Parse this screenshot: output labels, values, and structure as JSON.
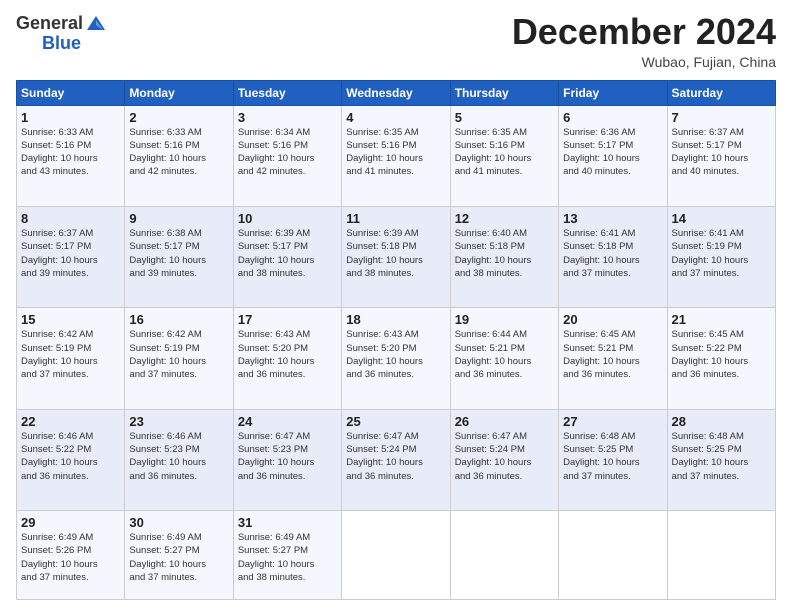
{
  "header": {
    "logo_general": "General",
    "logo_blue": "Blue",
    "month_title": "December 2024",
    "location": "Wubao, Fujian, China"
  },
  "days_of_week": [
    "Sunday",
    "Monday",
    "Tuesday",
    "Wednesday",
    "Thursday",
    "Friday",
    "Saturday"
  ],
  "weeks": [
    [
      {
        "day": "1",
        "info": "Sunrise: 6:33 AM\nSunset: 5:16 PM\nDaylight: 10 hours\nand 43 minutes."
      },
      {
        "day": "2",
        "info": "Sunrise: 6:33 AM\nSunset: 5:16 PM\nDaylight: 10 hours\nand 42 minutes."
      },
      {
        "day": "3",
        "info": "Sunrise: 6:34 AM\nSunset: 5:16 PM\nDaylight: 10 hours\nand 42 minutes."
      },
      {
        "day": "4",
        "info": "Sunrise: 6:35 AM\nSunset: 5:16 PM\nDaylight: 10 hours\nand 41 minutes."
      },
      {
        "day": "5",
        "info": "Sunrise: 6:35 AM\nSunset: 5:16 PM\nDaylight: 10 hours\nand 41 minutes."
      },
      {
        "day": "6",
        "info": "Sunrise: 6:36 AM\nSunset: 5:17 PM\nDaylight: 10 hours\nand 40 minutes."
      },
      {
        "day": "7",
        "info": "Sunrise: 6:37 AM\nSunset: 5:17 PM\nDaylight: 10 hours\nand 40 minutes."
      }
    ],
    [
      {
        "day": "8",
        "info": "Sunrise: 6:37 AM\nSunset: 5:17 PM\nDaylight: 10 hours\nand 39 minutes."
      },
      {
        "day": "9",
        "info": "Sunrise: 6:38 AM\nSunset: 5:17 PM\nDaylight: 10 hours\nand 39 minutes."
      },
      {
        "day": "10",
        "info": "Sunrise: 6:39 AM\nSunset: 5:17 PM\nDaylight: 10 hours\nand 38 minutes."
      },
      {
        "day": "11",
        "info": "Sunrise: 6:39 AM\nSunset: 5:18 PM\nDaylight: 10 hours\nand 38 minutes."
      },
      {
        "day": "12",
        "info": "Sunrise: 6:40 AM\nSunset: 5:18 PM\nDaylight: 10 hours\nand 38 minutes."
      },
      {
        "day": "13",
        "info": "Sunrise: 6:41 AM\nSunset: 5:18 PM\nDaylight: 10 hours\nand 37 minutes."
      },
      {
        "day": "14",
        "info": "Sunrise: 6:41 AM\nSunset: 5:19 PM\nDaylight: 10 hours\nand 37 minutes."
      }
    ],
    [
      {
        "day": "15",
        "info": "Sunrise: 6:42 AM\nSunset: 5:19 PM\nDaylight: 10 hours\nand 37 minutes."
      },
      {
        "day": "16",
        "info": "Sunrise: 6:42 AM\nSunset: 5:19 PM\nDaylight: 10 hours\nand 37 minutes."
      },
      {
        "day": "17",
        "info": "Sunrise: 6:43 AM\nSunset: 5:20 PM\nDaylight: 10 hours\nand 36 minutes."
      },
      {
        "day": "18",
        "info": "Sunrise: 6:43 AM\nSunset: 5:20 PM\nDaylight: 10 hours\nand 36 minutes."
      },
      {
        "day": "19",
        "info": "Sunrise: 6:44 AM\nSunset: 5:21 PM\nDaylight: 10 hours\nand 36 minutes."
      },
      {
        "day": "20",
        "info": "Sunrise: 6:45 AM\nSunset: 5:21 PM\nDaylight: 10 hours\nand 36 minutes."
      },
      {
        "day": "21",
        "info": "Sunrise: 6:45 AM\nSunset: 5:22 PM\nDaylight: 10 hours\nand 36 minutes."
      }
    ],
    [
      {
        "day": "22",
        "info": "Sunrise: 6:46 AM\nSunset: 5:22 PM\nDaylight: 10 hours\nand 36 minutes."
      },
      {
        "day": "23",
        "info": "Sunrise: 6:46 AM\nSunset: 5:23 PM\nDaylight: 10 hours\nand 36 minutes."
      },
      {
        "day": "24",
        "info": "Sunrise: 6:47 AM\nSunset: 5:23 PM\nDaylight: 10 hours\nand 36 minutes."
      },
      {
        "day": "25",
        "info": "Sunrise: 6:47 AM\nSunset: 5:24 PM\nDaylight: 10 hours\nand 36 minutes."
      },
      {
        "day": "26",
        "info": "Sunrise: 6:47 AM\nSunset: 5:24 PM\nDaylight: 10 hours\nand 36 minutes."
      },
      {
        "day": "27",
        "info": "Sunrise: 6:48 AM\nSunset: 5:25 PM\nDaylight: 10 hours\nand 37 minutes."
      },
      {
        "day": "28",
        "info": "Sunrise: 6:48 AM\nSunset: 5:25 PM\nDaylight: 10 hours\nand 37 minutes."
      }
    ],
    [
      {
        "day": "29",
        "info": "Sunrise: 6:49 AM\nSunset: 5:26 PM\nDaylight: 10 hours\nand 37 minutes."
      },
      {
        "day": "30",
        "info": "Sunrise: 6:49 AM\nSunset: 5:27 PM\nDaylight: 10 hours\nand 37 minutes."
      },
      {
        "day": "31",
        "info": "Sunrise: 6:49 AM\nSunset: 5:27 PM\nDaylight: 10 hours\nand 38 minutes."
      },
      {
        "day": "",
        "info": ""
      },
      {
        "day": "",
        "info": ""
      },
      {
        "day": "",
        "info": ""
      },
      {
        "day": "",
        "info": ""
      }
    ]
  ]
}
